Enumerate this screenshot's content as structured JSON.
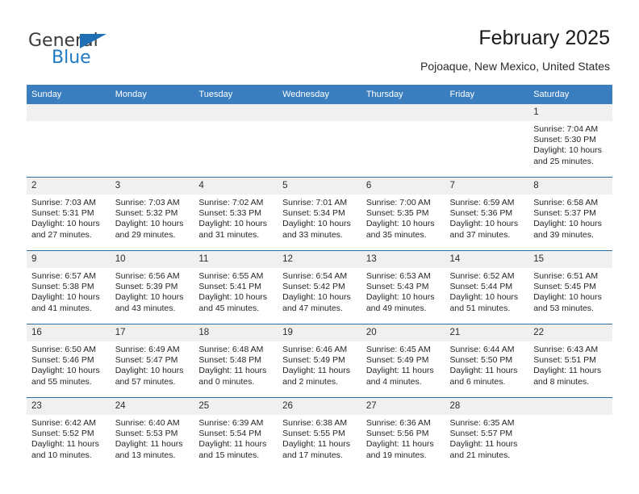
{
  "brand": {
    "name_part1": "General",
    "name_part2": "Blue",
    "triangle_color": "#1f6fb5",
    "blue_color": "#1f7ac4"
  },
  "header": {
    "title": "February 2025",
    "location": "Pojoaque, New Mexico, United States"
  },
  "theme": {
    "header_row_color": "#3a7ebf",
    "daynum_band_color": "#f0f0f0",
    "row_divider_color": "#2b6ca3",
    "text_color": "#262626"
  },
  "weekday_headers": [
    "Sunday",
    "Monday",
    "Tuesday",
    "Wednesday",
    "Thursday",
    "Friday",
    "Saturday"
  ],
  "labels": {
    "sunrise_prefix": "Sunrise:",
    "sunset_prefix": "Sunset:",
    "daylight_prefix": "Daylight:"
  },
  "weeks": [
    [
      {
        "day": "",
        "blank": true
      },
      {
        "day": "",
        "blank": true
      },
      {
        "day": "",
        "blank": true
      },
      {
        "day": "",
        "blank": true
      },
      {
        "day": "",
        "blank": true
      },
      {
        "day": "",
        "blank": true
      },
      {
        "day": "1",
        "sunrise": "Sunrise: 7:04 AM",
        "sunset": "Sunset: 5:30 PM",
        "daylight_line1": "Daylight: 10 hours",
        "daylight_line2": "and 25 minutes."
      }
    ],
    [
      {
        "day": "2",
        "sunrise": "Sunrise: 7:03 AM",
        "sunset": "Sunset: 5:31 PM",
        "daylight_line1": "Daylight: 10 hours",
        "daylight_line2": "and 27 minutes."
      },
      {
        "day": "3",
        "sunrise": "Sunrise: 7:03 AM",
        "sunset": "Sunset: 5:32 PM",
        "daylight_line1": "Daylight: 10 hours",
        "daylight_line2": "and 29 minutes."
      },
      {
        "day": "4",
        "sunrise": "Sunrise: 7:02 AM",
        "sunset": "Sunset: 5:33 PM",
        "daylight_line1": "Daylight: 10 hours",
        "daylight_line2": "and 31 minutes."
      },
      {
        "day": "5",
        "sunrise": "Sunrise: 7:01 AM",
        "sunset": "Sunset: 5:34 PM",
        "daylight_line1": "Daylight: 10 hours",
        "daylight_line2": "and 33 minutes."
      },
      {
        "day": "6",
        "sunrise": "Sunrise: 7:00 AM",
        "sunset": "Sunset: 5:35 PM",
        "daylight_line1": "Daylight: 10 hours",
        "daylight_line2": "and 35 minutes."
      },
      {
        "day": "7",
        "sunrise": "Sunrise: 6:59 AM",
        "sunset": "Sunset: 5:36 PM",
        "daylight_line1": "Daylight: 10 hours",
        "daylight_line2": "and 37 minutes."
      },
      {
        "day": "8",
        "sunrise": "Sunrise: 6:58 AM",
        "sunset": "Sunset: 5:37 PM",
        "daylight_line1": "Daylight: 10 hours",
        "daylight_line2": "and 39 minutes."
      }
    ],
    [
      {
        "day": "9",
        "sunrise": "Sunrise: 6:57 AM",
        "sunset": "Sunset: 5:38 PM",
        "daylight_line1": "Daylight: 10 hours",
        "daylight_line2": "and 41 minutes."
      },
      {
        "day": "10",
        "sunrise": "Sunrise: 6:56 AM",
        "sunset": "Sunset: 5:39 PM",
        "daylight_line1": "Daylight: 10 hours",
        "daylight_line2": "and 43 minutes."
      },
      {
        "day": "11",
        "sunrise": "Sunrise: 6:55 AM",
        "sunset": "Sunset: 5:41 PM",
        "daylight_line1": "Daylight: 10 hours",
        "daylight_line2": "and 45 minutes."
      },
      {
        "day": "12",
        "sunrise": "Sunrise: 6:54 AM",
        "sunset": "Sunset: 5:42 PM",
        "daylight_line1": "Daylight: 10 hours",
        "daylight_line2": "and 47 minutes."
      },
      {
        "day": "13",
        "sunrise": "Sunrise: 6:53 AM",
        "sunset": "Sunset: 5:43 PM",
        "daylight_line1": "Daylight: 10 hours",
        "daylight_line2": "and 49 minutes."
      },
      {
        "day": "14",
        "sunrise": "Sunrise: 6:52 AM",
        "sunset": "Sunset: 5:44 PM",
        "daylight_line1": "Daylight: 10 hours",
        "daylight_line2": "and 51 minutes."
      },
      {
        "day": "15",
        "sunrise": "Sunrise: 6:51 AM",
        "sunset": "Sunset: 5:45 PM",
        "daylight_line1": "Daylight: 10 hours",
        "daylight_line2": "and 53 minutes."
      }
    ],
    [
      {
        "day": "16",
        "sunrise": "Sunrise: 6:50 AM",
        "sunset": "Sunset: 5:46 PM",
        "daylight_line1": "Daylight: 10 hours",
        "daylight_line2": "and 55 minutes."
      },
      {
        "day": "17",
        "sunrise": "Sunrise: 6:49 AM",
        "sunset": "Sunset: 5:47 PM",
        "daylight_line1": "Daylight: 10 hours",
        "daylight_line2": "and 57 minutes."
      },
      {
        "day": "18",
        "sunrise": "Sunrise: 6:48 AM",
        "sunset": "Sunset: 5:48 PM",
        "daylight_line1": "Daylight: 11 hours",
        "daylight_line2": "and 0 minutes."
      },
      {
        "day": "19",
        "sunrise": "Sunrise: 6:46 AM",
        "sunset": "Sunset: 5:49 PM",
        "daylight_line1": "Daylight: 11 hours",
        "daylight_line2": "and 2 minutes."
      },
      {
        "day": "20",
        "sunrise": "Sunrise: 6:45 AM",
        "sunset": "Sunset: 5:49 PM",
        "daylight_line1": "Daylight: 11 hours",
        "daylight_line2": "and 4 minutes."
      },
      {
        "day": "21",
        "sunrise": "Sunrise: 6:44 AM",
        "sunset": "Sunset: 5:50 PM",
        "daylight_line1": "Daylight: 11 hours",
        "daylight_line2": "and 6 minutes."
      },
      {
        "day": "22",
        "sunrise": "Sunrise: 6:43 AM",
        "sunset": "Sunset: 5:51 PM",
        "daylight_line1": "Daylight: 11 hours",
        "daylight_line2": "and 8 minutes."
      }
    ],
    [
      {
        "day": "23",
        "sunrise": "Sunrise: 6:42 AM",
        "sunset": "Sunset: 5:52 PM",
        "daylight_line1": "Daylight: 11 hours",
        "daylight_line2": "and 10 minutes."
      },
      {
        "day": "24",
        "sunrise": "Sunrise: 6:40 AM",
        "sunset": "Sunset: 5:53 PM",
        "daylight_line1": "Daylight: 11 hours",
        "daylight_line2": "and 13 minutes."
      },
      {
        "day": "25",
        "sunrise": "Sunrise: 6:39 AM",
        "sunset": "Sunset: 5:54 PM",
        "daylight_line1": "Daylight: 11 hours",
        "daylight_line2": "and 15 minutes."
      },
      {
        "day": "26",
        "sunrise": "Sunrise: 6:38 AM",
        "sunset": "Sunset: 5:55 PM",
        "daylight_line1": "Daylight: 11 hours",
        "daylight_line2": "and 17 minutes."
      },
      {
        "day": "27",
        "sunrise": "Sunrise: 6:36 AM",
        "sunset": "Sunset: 5:56 PM",
        "daylight_line1": "Daylight: 11 hours",
        "daylight_line2": "and 19 minutes."
      },
      {
        "day": "28",
        "sunrise": "Sunrise: 6:35 AM",
        "sunset": "Sunset: 5:57 PM",
        "daylight_line1": "Daylight: 11 hours",
        "daylight_line2": "and 21 minutes."
      },
      {
        "day": "",
        "blank": true
      }
    ]
  ]
}
